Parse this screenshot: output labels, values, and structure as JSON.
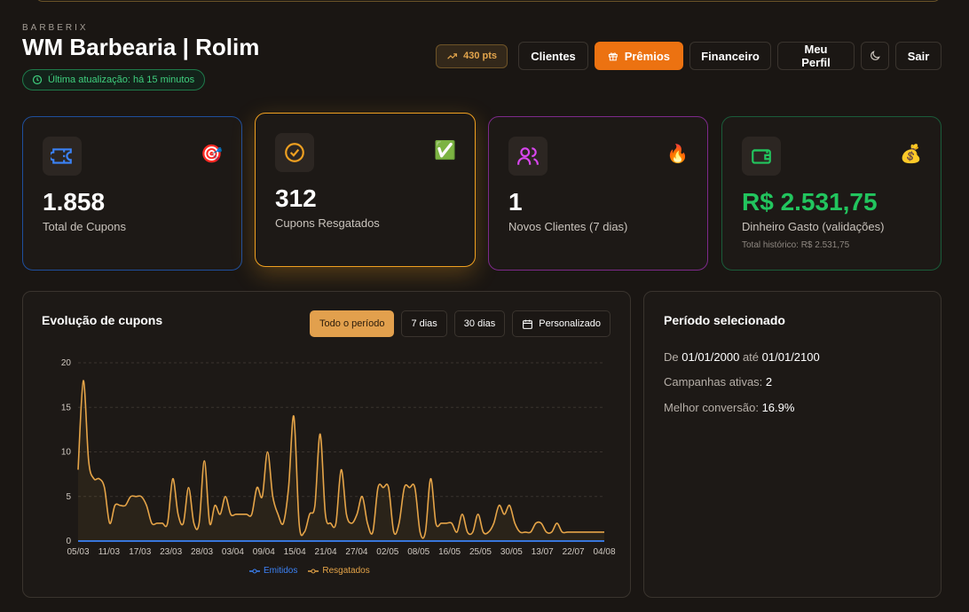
{
  "header": {
    "brand": "BARBERIX",
    "title": "WM Barbearia | Rolim",
    "update": "Última atualização: há 15 minutos"
  },
  "nav": {
    "points": "430 pts",
    "clientes": "Clientes",
    "premios": "Prêmios",
    "financeiro": "Financeiro",
    "perfil": "Meu Perfil",
    "sair": "Sair"
  },
  "stats": [
    {
      "value": "1.858",
      "label": "Total de Cupons",
      "emoji": "🎯",
      "icon": "ticket-icon",
      "accent": "#2b6fde"
    },
    {
      "value": "312",
      "label": "Cupons Resgatados",
      "emoji": "✅",
      "icon": "check-circle-icon",
      "accent": "#f0a020"
    },
    {
      "value": "1",
      "label": "Novos Clientes (7 dias)",
      "emoji": "🔥",
      "icon": "users-icon",
      "accent": "#c73bd8"
    },
    {
      "value": "R$ 2.531,75",
      "label": "Dinheiro Gasto (validações)",
      "sub": "Total histórico: R$ 2.531,75",
      "emoji": "💰",
      "icon": "wallet-icon",
      "accent": "#1f9a5d"
    }
  ],
  "evolution": {
    "title": "Evolução de cupons",
    "filters": [
      "Todo o período",
      "7 dias",
      "30 dias",
      "Personalizado"
    ],
    "active_filter": "Todo o período"
  },
  "period": {
    "title": "Período selecionado",
    "de_label": "De",
    "start": "01/01/2000",
    "ate_label": "até",
    "end": "01/01/2100",
    "campanhas_label": "Campanhas ativas:",
    "campanhas": "2",
    "conversao_label": "Melhor conversão:",
    "conversao": "16.9%"
  },
  "chart_data": {
    "type": "line",
    "categories": [
      "05/03",
      "11/03",
      "17/03",
      "23/03",
      "28/03",
      "03/04",
      "09/04",
      "15/04",
      "21/04",
      "27/04",
      "02/05",
      "08/05",
      "16/05",
      "25/05",
      "30/05",
      "13/07",
      "22/07",
      "04/08"
    ],
    "ylim": [
      0,
      20
    ],
    "yticks": [
      0,
      5,
      10,
      15,
      20
    ],
    "series": [
      {
        "name": "Emitidos",
        "color": "#3b82f6",
        "values": [
          0,
          0,
          0,
          0,
          0,
          0,
          0,
          0,
          0,
          0,
          0,
          0,
          0,
          0,
          0,
          0,
          0,
          0,
          0,
          0,
          0,
          0,
          0,
          0,
          0,
          0,
          0,
          0,
          0,
          0,
          0,
          0,
          0,
          0,
          0,
          0,
          0,
          0,
          0,
          0,
          0,
          0,
          0,
          0,
          0,
          0,
          0,
          0,
          0,
          0,
          0,
          0,
          0,
          0,
          0,
          0,
          0,
          0,
          0,
          0,
          0,
          0,
          0,
          0,
          0,
          0,
          0,
          0,
          0,
          0,
          0,
          0,
          0,
          0,
          0,
          0,
          0,
          0,
          0,
          0,
          0,
          0,
          0,
          0,
          0,
          0,
          0,
          0,
          0,
          0,
          0,
          0,
          0,
          0,
          0,
          0,
          0,
          0,
          0,
          0,
          0
        ]
      },
      {
        "name": "Resgatados",
        "color": "#e5a448",
        "values": [
          8,
          18,
          9,
          7,
          7,
          6,
          2,
          4,
          4,
          4,
          5,
          5,
          5,
          4,
          2,
          2,
          2,
          2,
          7,
          3,
          2,
          6,
          2,
          2,
          9,
          2,
          4,
          3,
          5,
          3,
          3,
          3,
          3,
          3,
          6,
          5,
          10,
          5,
          3,
          2,
          6,
          14,
          2,
          1,
          3,
          4,
          12,
          3,
          2,
          2,
          8,
          3,
          2,
          3,
          5,
          2,
          1,
          6,
          6,
          6,
          1,
          2,
          6,
          6,
          6,
          1,
          1,
          7,
          2,
          2,
          2,
          2,
          1,
          3,
          1,
          1,
          3,
          1,
          1,
          2,
          4,
          3,
          4,
          2,
          1,
          1,
          1,
          2,
          2,
          1,
          1,
          2,
          1,
          1,
          1,
          1,
          1,
          1,
          1,
          1,
          1
        ]
      }
    ]
  }
}
